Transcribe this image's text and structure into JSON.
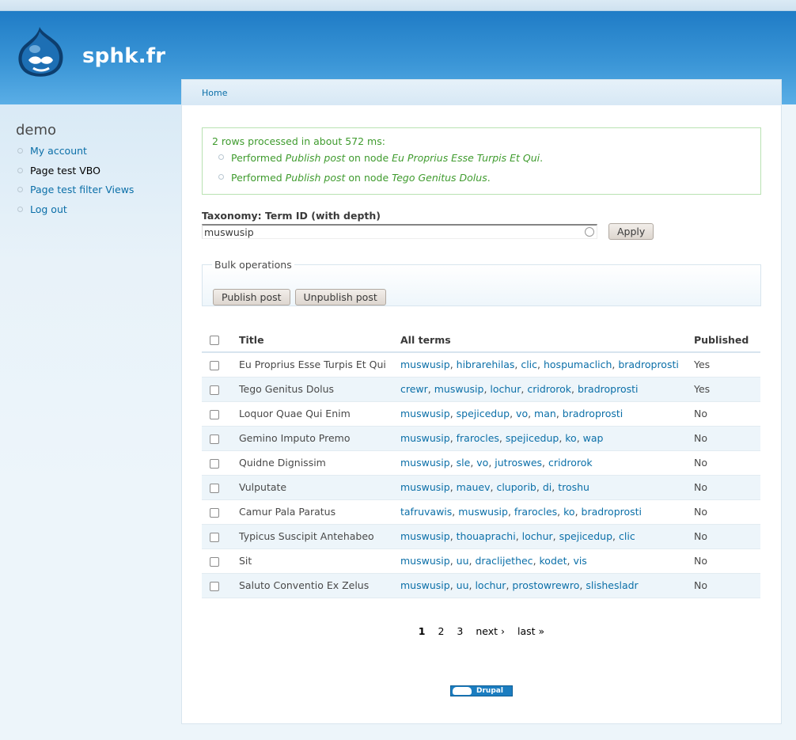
{
  "site": {
    "name": "sphk.fr"
  },
  "sidebar": {
    "title": "demo",
    "items": [
      {
        "label": "My account"
      },
      {
        "label": "Page test VBO"
      },
      {
        "label": "Page test filter Views"
      },
      {
        "label": "Log out"
      }
    ]
  },
  "breadcrumb": {
    "home": "Home"
  },
  "message": {
    "summary": "2 rows processed in about 572 ms:",
    "items": [
      {
        "prefix": "Performed ",
        "action": "Publish post",
        "mid": " on node ",
        "node": "Eu Proprius Esse Turpis Et Qui",
        "suffix": "."
      },
      {
        "prefix": "Performed ",
        "action": "Publish post",
        "mid": " on node ",
        "node": "Tego Genitus Dolus",
        "suffix": "."
      }
    ]
  },
  "filter": {
    "label": "Taxonomy: Term ID (with depth)",
    "value": "muswusip",
    "apply_label": "Apply"
  },
  "bulk": {
    "legend": "Bulk operations",
    "publish_label": "Publish post",
    "unpublish_label": "Unpublish post"
  },
  "table": {
    "headers": {
      "title": "Title",
      "terms": "All terms",
      "published": "Published"
    },
    "rows": [
      {
        "title": "Eu Proprius Esse Turpis Et Qui",
        "terms": [
          "muswusip",
          "hibrarehilas",
          "clic",
          "hospumaclich",
          "bradroprosti"
        ],
        "published": "Yes"
      },
      {
        "title": "Tego Genitus Dolus",
        "terms": [
          "crewr",
          "muswusip",
          "lochur",
          "cridrorok",
          "bradroprosti"
        ],
        "published": "Yes"
      },
      {
        "title": "Loquor Quae Qui Enim",
        "terms": [
          "muswusip",
          "spejicedup",
          "vo",
          "man",
          "bradroprosti"
        ],
        "published": "No"
      },
      {
        "title": "Gemino Imputo Premo",
        "terms": [
          "muswusip",
          "frarocles",
          "spejicedup",
          "ko",
          "wap"
        ],
        "published": "No"
      },
      {
        "title": "Quidne Dignissim",
        "terms": [
          "muswusip",
          "sle",
          "vo",
          "jutroswes",
          "cridrorok"
        ],
        "published": "No"
      },
      {
        "title": "Vulputate",
        "terms": [
          "muswusip",
          "mauev",
          "cluporib",
          "di",
          "troshu"
        ],
        "published": "No"
      },
      {
        "title": "Camur Pala Paratus",
        "terms": [
          "tafruvawis",
          "muswusip",
          "frarocles",
          "ko",
          "bradroprosti"
        ],
        "published": "No"
      },
      {
        "title": "Typicus Suscipit Antehabeo",
        "terms": [
          "muswusip",
          "thouaprachi",
          "lochur",
          "spejicedup",
          "clic"
        ],
        "published": "No"
      },
      {
        "title": "Sit",
        "terms": [
          "muswusip",
          "uu",
          "draclijethec",
          "kodet",
          "vis"
        ],
        "published": "No"
      },
      {
        "title": "Saluto Conventio Ex Zelus",
        "terms": [
          "muswusip",
          "uu",
          "lochur",
          "prostowrewro",
          "slishesladr"
        ],
        "published": "No"
      }
    ]
  },
  "pager": {
    "pages": [
      "1",
      "2",
      "3"
    ],
    "current": "1",
    "next": "next ›",
    "last": "last »"
  },
  "footer": {
    "badge": "Drupal"
  },
  "colors": {
    "link": "#0b6fa8",
    "status": "#3f9b2e",
    "header": "#1f7cc6"
  }
}
